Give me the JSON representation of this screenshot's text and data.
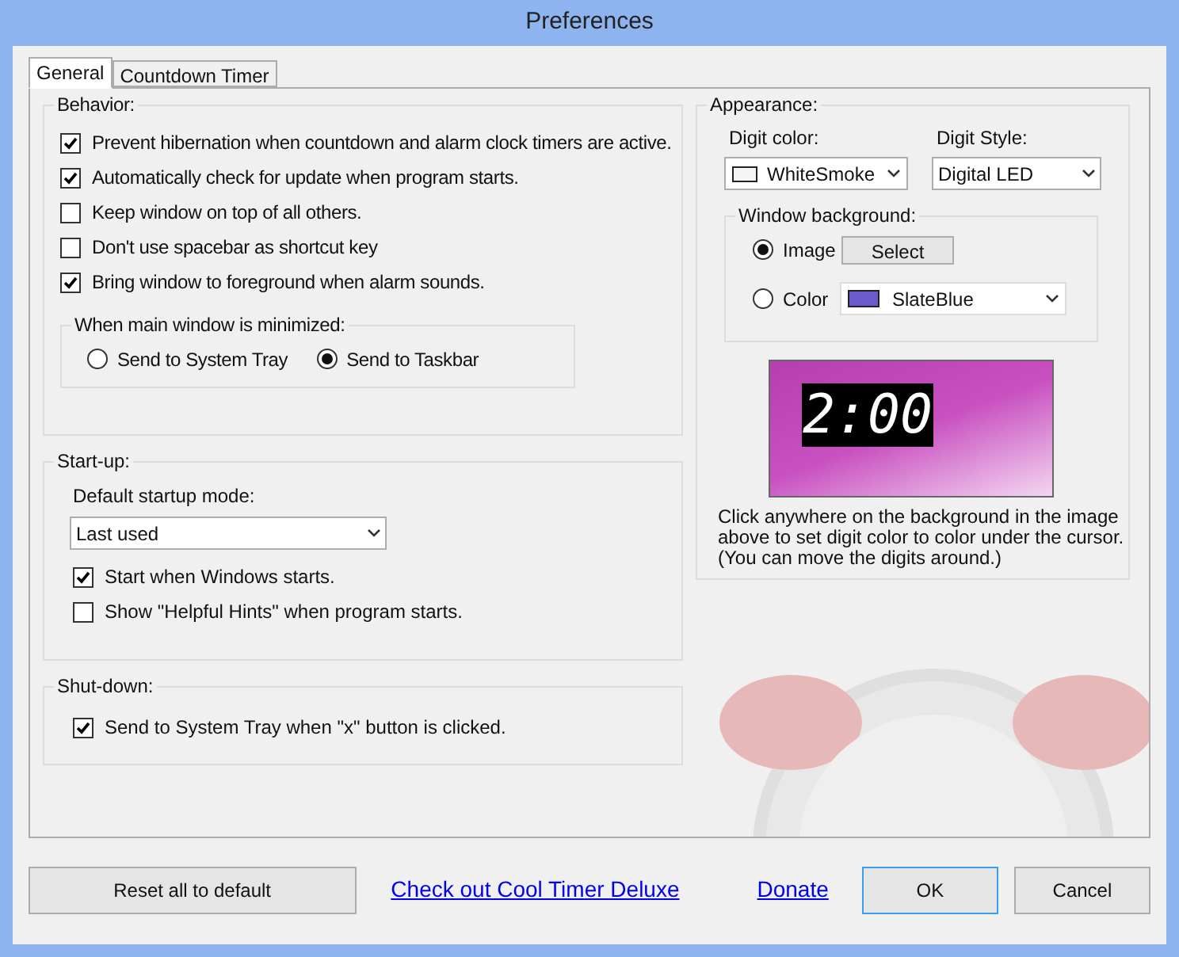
{
  "window": {
    "title": "Preferences"
  },
  "tabs": [
    {
      "label": "General",
      "selected": true
    },
    {
      "label": "Countdown Timer",
      "selected": false
    }
  ],
  "behavior": {
    "title": "Behavior:",
    "options": [
      {
        "label": "Prevent hibernation when countdown and alarm clock timers are active.",
        "checked": true
      },
      {
        "label": "Automatically check for update when program starts.",
        "checked": true
      },
      {
        "label": "Keep window on top of all others.",
        "checked": false
      },
      {
        "label": "Don't use spacebar as shortcut key",
        "checked": false
      },
      {
        "label": "Bring window to foreground when alarm sounds.",
        "checked": true
      }
    ],
    "minimized": {
      "title": "When main window is minimized:",
      "options": [
        {
          "label": "Send to System Tray",
          "selected": false
        },
        {
          "label": "Send to Taskbar",
          "selected": true
        }
      ]
    }
  },
  "startup": {
    "title": "Start-up:",
    "mode_label": "Default startup mode:",
    "mode_value": "Last used",
    "options": [
      {
        "label": "Start when Windows starts.",
        "checked": true
      },
      {
        "label": "Show \"Helpful Hints\" when program starts.",
        "checked": false
      }
    ]
  },
  "shutdown": {
    "title": "Shut-down:",
    "options": [
      {
        "label": "Send to System Tray when \"x\" button is clicked.",
        "checked": true
      }
    ]
  },
  "appearance": {
    "title": "Appearance:",
    "digit_color_label": "Digit color:",
    "digit_color_value": "WhiteSmoke",
    "digit_style_label": "Digit Style:",
    "digit_style_value": "Digital LED",
    "background": {
      "title": "Window background:",
      "options": [
        {
          "label": "Image",
          "selected": true,
          "kind": "button",
          "button": "Select"
        },
        {
          "label": "Color",
          "selected": false,
          "kind": "dropdown",
          "value": "SlateBlue"
        }
      ]
    },
    "preview_time": "2:00",
    "note": "Click anywhere on the background in the image above to set digit color to color under the cursor. (You can move the digits around.)"
  },
  "footer": {
    "reset": "Reset all to default",
    "links": [
      "Check out Cool Timer Deluxe",
      "Donate"
    ],
    "ok": "OK",
    "cancel": "Cancel"
  }
}
